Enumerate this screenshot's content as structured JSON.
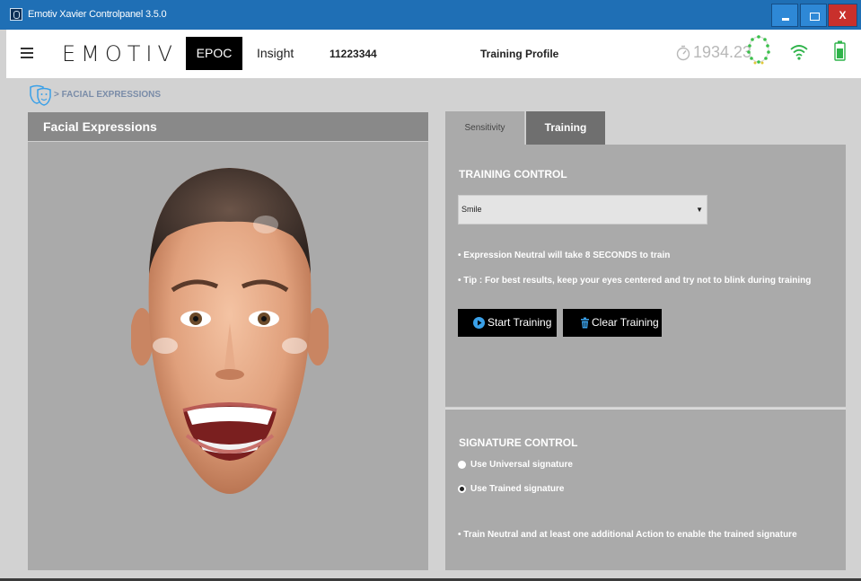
{
  "window": {
    "title": "Emotiv Xavier Controlpanel 3.5.0",
    "close_label": "X"
  },
  "header": {
    "logo": "EMOTIV",
    "device_button": "EPOC",
    "device_alt": "Insight",
    "serial": "11223344",
    "profile": "Training Profile",
    "timer": "1934.23"
  },
  "breadcrumb": {
    "text": "> FACIAL EXPRESSIONS"
  },
  "left_panel": {
    "title": "Facial Expressions"
  },
  "tabs": [
    {
      "label": "Sensitivity"
    },
    {
      "label": "Training"
    }
  ],
  "training": {
    "section_title": "TRAINING CONTROL",
    "select_value": "Smile",
    "info1": "• Expression Neutral will take 8 SECONDS to train",
    "info2": "• Tip : For best results, keep your eyes centered and try not to blink during training",
    "start_label": "Start Training",
    "clear_label": "Clear Training"
  },
  "signature": {
    "section_title": "SIGNATURE CONTROL",
    "options": [
      {
        "label": "Use Universal signature",
        "checked": false
      },
      {
        "label": "Use Trained signature",
        "checked": true
      }
    ],
    "note": "• Train Neutral and at least one additional Action to enable the trained signature"
  },
  "colors": {
    "titlebar": "#1f6fb5",
    "close": "#c9302c",
    "panel": "#aaaaaa",
    "accent_blue": "#3aa0e8",
    "battery": "#2fb34a"
  }
}
